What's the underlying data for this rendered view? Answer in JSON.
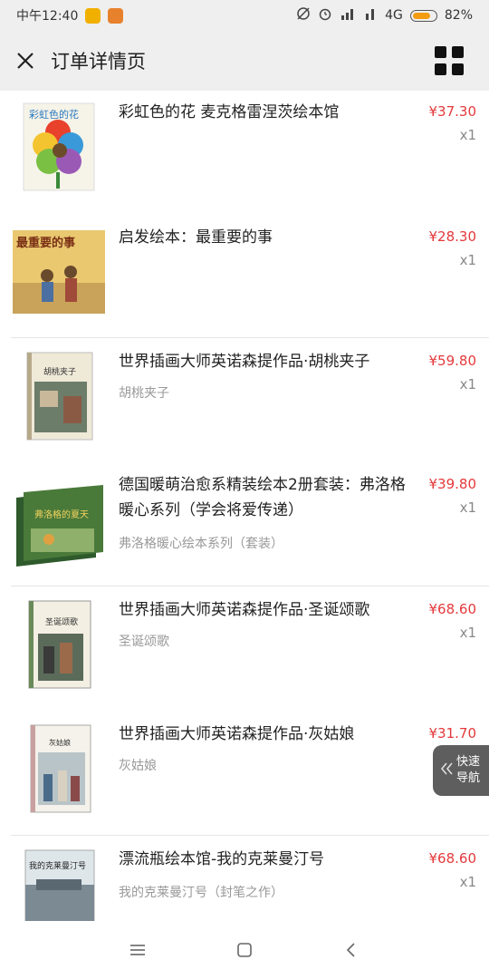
{
  "status_bar": {
    "time": "中午12:40",
    "network": "4G",
    "battery": "82%",
    "battery_level": 0.82,
    "icons": [
      "notification-app-icon",
      "notification-app-icon",
      "sync-off-icon",
      "alarm-icon",
      "hd-signal-icon",
      "signal-icon"
    ]
  },
  "header": {
    "title": "订单详情页",
    "close_icon": "close-icon",
    "menu_icon": "grid-menu-icon"
  },
  "products": [
    {
      "name": "彩虹色的花 麦克格雷涅茨绘本馆",
      "subtitle": "",
      "price": "¥37.30",
      "qty": "x1"
    },
    {
      "name": "启发绘本：最重要的事",
      "subtitle": "",
      "price": "¥28.30",
      "qty": "x1"
    },
    {
      "name": "世界插画大师英诺森提作品·胡桃夹子",
      "subtitle": "胡桃夹子",
      "price": "¥59.80",
      "qty": "x1"
    },
    {
      "name": "德国暖萌治愈系精装绘本2册套装：弗洛格暖心系列（学会将爱传递）",
      "subtitle": "弗洛格暖心绘本系列（套装）",
      "price": "¥39.80",
      "qty": "x1"
    },
    {
      "name": "世界插画大师英诺森提作品·圣诞颂歌",
      "subtitle": "圣诞颂歌",
      "price": "¥68.60",
      "qty": "x1"
    },
    {
      "name": "世界插画大师英诺森提作品·灰姑娘",
      "subtitle": "灰姑娘",
      "price": "¥31.70",
      "qty": "x1"
    },
    {
      "name": "漂流瓶绘本馆-我的克莱曼汀号",
      "subtitle": "我的克莱曼汀号（封笔之作）",
      "price": "¥68.60",
      "qty": "x1"
    }
  ],
  "cover_texts": {
    "c1": "彩虹色的花",
    "c2": "最重要的事",
    "c3": "胡桃夹子",
    "c4": "弗洛格的夏天",
    "c5": "圣诞颂歌",
    "c6": "灰姑娘",
    "c7": "我的克莱曼汀号"
  },
  "quick_nav": {
    "line1": "快速",
    "line2": "导航"
  },
  "nav_bar": {
    "icons": [
      "menu-icon",
      "home-icon",
      "back-icon"
    ]
  },
  "colors": {
    "price": "#e4393c",
    "header_bg": "#efefef",
    "quick_nav_bg": "#5e5e5e"
  }
}
